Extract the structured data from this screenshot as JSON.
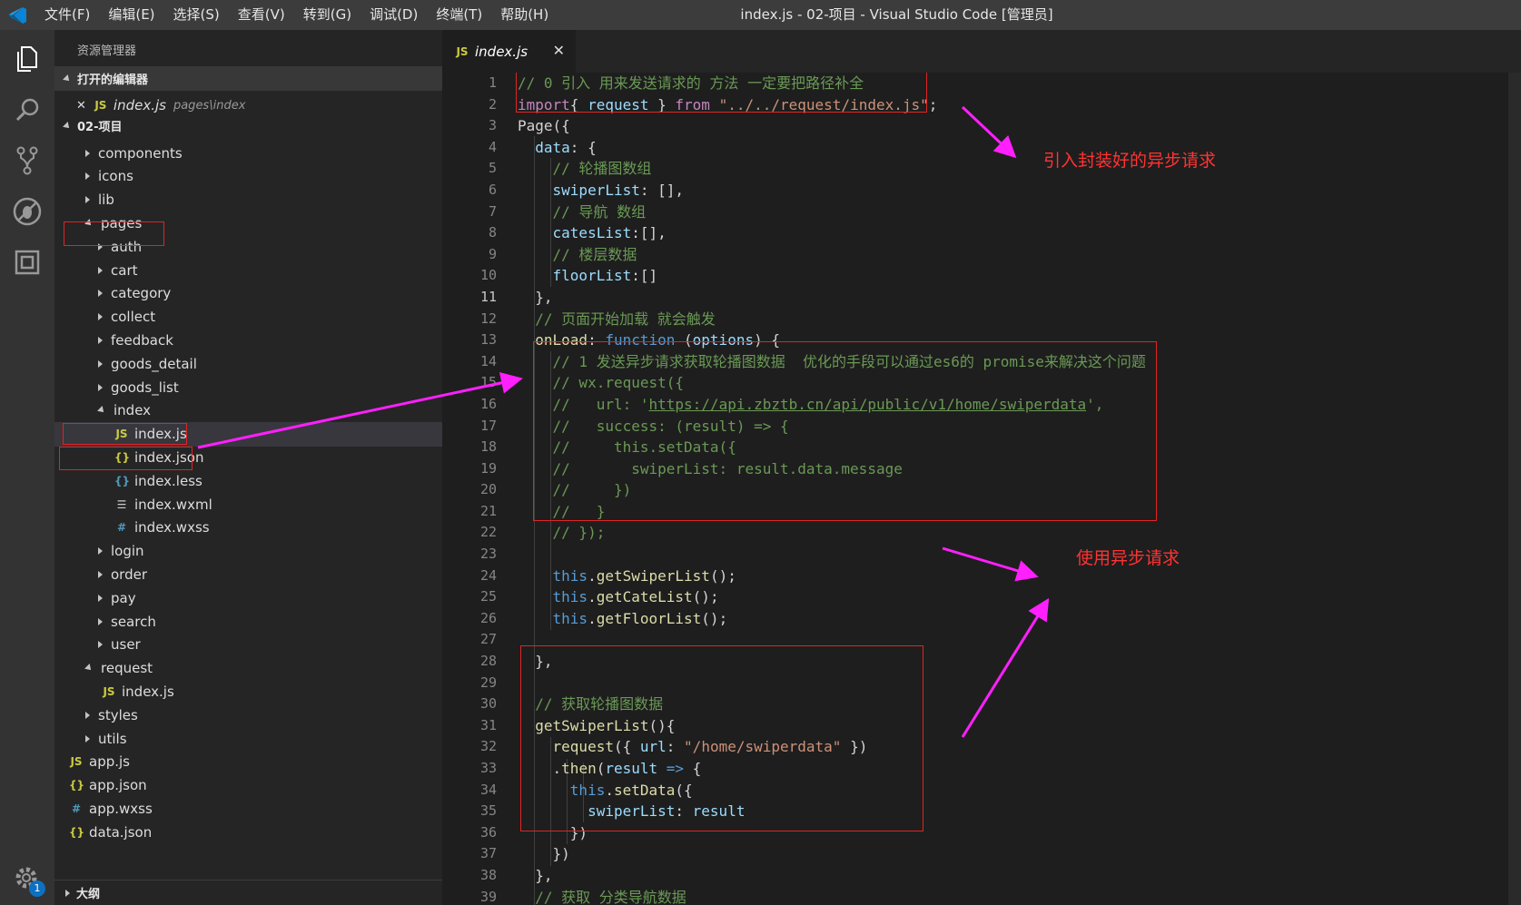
{
  "menu": [
    "文件(F)",
    "编辑(E)",
    "选择(S)",
    "查看(V)",
    "转到(G)",
    "调试(D)",
    "终端(T)",
    "帮助(H)"
  ],
  "window_title": "index.js - 02-项目 - Visual Studio Code [管理员]",
  "badge_count": "1",
  "sidebar": {
    "title": "资源管理器",
    "open_editors_label": "打开的编辑器",
    "open_editor": {
      "close": "✕",
      "name": "index.js",
      "path": "pages\\index"
    },
    "project_label": "02-项目",
    "outline_label": "大纲",
    "tree": [
      {
        "label": "components",
        "kind": "folder"
      },
      {
        "label": "icons",
        "kind": "folder"
      },
      {
        "label": "lib",
        "kind": "folder"
      },
      {
        "label": "pages",
        "kind": "folder-open"
      },
      {
        "label": "auth",
        "kind": "folder"
      },
      {
        "label": "cart",
        "kind": "folder"
      },
      {
        "label": "category",
        "kind": "folder"
      },
      {
        "label": "collect",
        "kind": "folder"
      },
      {
        "label": "feedback",
        "kind": "folder"
      },
      {
        "label": "goods_detail",
        "kind": "folder"
      },
      {
        "label": "goods_list",
        "kind": "folder"
      },
      {
        "label": "index",
        "kind": "folder-open"
      },
      {
        "label": "index.js",
        "kind": "js"
      },
      {
        "label": "index.json",
        "kind": "json"
      },
      {
        "label": "index.less",
        "kind": "less"
      },
      {
        "label": "index.wxml",
        "kind": "wxml"
      },
      {
        "label": "index.wxss",
        "kind": "wxss"
      },
      {
        "label": "login",
        "kind": "folder"
      },
      {
        "label": "order",
        "kind": "folder"
      },
      {
        "label": "pay",
        "kind": "folder"
      },
      {
        "label": "search",
        "kind": "folder"
      },
      {
        "label": "user",
        "kind": "folder"
      },
      {
        "label": "request",
        "kind": "folder-open"
      },
      {
        "label": "index.js",
        "kind": "js"
      },
      {
        "label": "styles",
        "kind": "folder"
      },
      {
        "label": "utils",
        "kind": "folder"
      },
      {
        "label": "app.js",
        "kind": "js"
      },
      {
        "label": "app.json",
        "kind": "json"
      },
      {
        "label": "app.wxss",
        "kind": "wxss"
      },
      {
        "label": "data.json",
        "kind": "json"
      }
    ]
  },
  "tab": {
    "icon": "JS",
    "name": "index.js",
    "close": "✕"
  },
  "icon_glyphs": {
    "js": "JS",
    "json": "{}",
    "less": "{}",
    "wxml": "☰",
    "wxss": "#"
  },
  "line_numbers": [
    "1",
    "2",
    "3",
    "4",
    "5",
    "6",
    "7",
    "8",
    "9",
    "10",
    "11",
    "12",
    "13",
    "14",
    "15",
    "16",
    "17",
    "18",
    "19",
    "20",
    "21",
    "22",
    "23",
    "24",
    "25",
    "26",
    "27",
    "28",
    "29",
    "30",
    "31",
    "32",
    "33",
    "34",
    "35",
    "36",
    "37",
    "38",
    "39"
  ],
  "current_line": "11",
  "code": [
    [
      [
        "cm",
        "// 0 引入 用来发送请求的 方法 一定要把路径补全"
      ]
    ],
    [
      [
        "kw",
        "import"
      ],
      [
        "",
        "{ "
      ],
      [
        "pr",
        "request"
      ],
      [
        "",
        " } "
      ],
      [
        "kw",
        "from"
      ],
      [
        "",
        " "
      ],
      [
        "st",
        "\"../../request/index.js\""
      ],
      [
        "",
        ";"
      ]
    ],
    [
      [
        "",
        "Page({"
      ]
    ],
    [
      [
        "",
        "  "
      ],
      [
        "pr",
        "data"
      ],
      [
        "",
        ": {"
      ]
    ],
    [
      [
        "",
        "    "
      ],
      [
        "cm",
        "// 轮播图数组"
      ]
    ],
    [
      [
        "",
        "    "
      ],
      [
        "pr",
        "swiperList"
      ],
      [
        "",
        ": [],"
      ]
    ],
    [
      [
        "",
        "    "
      ],
      [
        "cm",
        "// 导航 数组"
      ]
    ],
    [
      [
        "",
        "    "
      ],
      [
        "pr",
        "catesList"
      ],
      [
        "",
        ":[],"
      ]
    ],
    [
      [
        "",
        "    "
      ],
      [
        "cm",
        "// 楼层数据"
      ]
    ],
    [
      [
        "",
        "    "
      ],
      [
        "pr",
        "floorList"
      ],
      [
        "",
        ":[]"
      ]
    ],
    [
      [
        "",
        "  },"
      ]
    ],
    [
      [
        "",
        "  "
      ],
      [
        "cm",
        "// 页面开始加载 就会触发"
      ]
    ],
    [
      [
        "",
        "  "
      ],
      [
        "fn",
        "onLoad"
      ],
      [
        "",
        ": "
      ],
      [
        "bl",
        "function"
      ],
      [
        "",
        " ("
      ],
      [
        "pr",
        "options"
      ],
      [
        "",
        ") {"
      ]
    ],
    [
      [
        "",
        "    "
      ],
      [
        "cm",
        "// 1 发送异步请求获取轮播图数据  优化的手段可以通过es6的 promise来解决这个问题"
      ]
    ],
    [
      [
        "",
        "    "
      ],
      [
        "cm",
        "// wx.request({"
      ]
    ],
    [
      [
        "",
        "    "
      ],
      [
        "cm",
        "//   url: '"
      ],
      [
        "cm url",
        "https://api.zbztb.cn/api/public/v1/home/swiperdata"
      ],
      [
        "cm",
        "',"
      ]
    ],
    [
      [
        "",
        "    "
      ],
      [
        "cm",
        "//   success: (result) => {"
      ]
    ],
    [
      [
        "",
        "    "
      ],
      [
        "cm",
        "//     this.setData({"
      ]
    ],
    [
      [
        "",
        "    "
      ],
      [
        "cm",
        "//       swiperList: result.data.message"
      ]
    ],
    [
      [
        "",
        "    "
      ],
      [
        "cm",
        "//     })"
      ]
    ],
    [
      [
        "",
        "    "
      ],
      [
        "cm",
        "//   }"
      ]
    ],
    [
      [
        "",
        "    "
      ],
      [
        "cm",
        "// });"
      ]
    ],
    [
      [
        "",
        ""
      ]
    ],
    [
      [
        "",
        "    "
      ],
      [
        "bl",
        "this"
      ],
      [
        "",
        "."
      ],
      [
        "fn",
        "getSwiperList"
      ],
      [
        "",
        "();"
      ]
    ],
    [
      [
        "",
        "    "
      ],
      [
        "bl",
        "this"
      ],
      [
        "",
        "."
      ],
      [
        "fn",
        "getCateList"
      ],
      [
        "",
        "();"
      ]
    ],
    [
      [
        "",
        "    "
      ],
      [
        "bl",
        "this"
      ],
      [
        "",
        "."
      ],
      [
        "fn",
        "getFloorList"
      ],
      [
        "",
        "();"
      ]
    ],
    [
      [
        "",
        ""
      ]
    ],
    [
      [
        "",
        "  },"
      ]
    ],
    [
      [
        "",
        ""
      ]
    ],
    [
      [
        "",
        "  "
      ],
      [
        "cm",
        "// 获取轮播图数据"
      ]
    ],
    [
      [
        "",
        "  "
      ],
      [
        "fn",
        "getSwiperList"
      ],
      [
        "",
        "(){"
      ]
    ],
    [
      [
        "",
        "    "
      ],
      [
        "fn",
        "request"
      ],
      [
        "",
        "({ "
      ],
      [
        "pr",
        "url"
      ],
      [
        "",
        ": "
      ],
      [
        "st",
        "\"/home/swiperdata\""
      ],
      [
        "",
        " })"
      ]
    ],
    [
      [
        "",
        "    ."
      ],
      [
        "fn",
        "then"
      ],
      [
        "",
        "("
      ],
      [
        "pr",
        "result"
      ],
      [
        "",
        " "
      ],
      [
        "bl",
        "=>"
      ],
      [
        "",
        " {"
      ]
    ],
    [
      [
        "",
        "      "
      ],
      [
        "bl",
        "this"
      ],
      [
        "",
        "."
      ],
      [
        "fn",
        "setData"
      ],
      [
        "",
        "({"
      ]
    ],
    [
      [
        "",
        "        "
      ],
      [
        "pr",
        "swiperList"
      ],
      [
        "",
        ": "
      ],
      [
        "pr",
        "result"
      ]
    ],
    [
      [
        "",
        "      })"
      ]
    ],
    [
      [
        "",
        "    })"
      ]
    ],
    [
      [
        "",
        "  },"
      ]
    ],
    [
      [
        "",
        "  "
      ],
      [
        "cm",
        "// 获取 分类导航数据"
      ]
    ]
  ],
  "annotations": {
    "import_note": "引入封装好的异步请求",
    "use_note": "使用异步请求"
  },
  "colors": {
    "annotation_red": "#e02424",
    "arrow_magenta": "#ff1fff"
  }
}
